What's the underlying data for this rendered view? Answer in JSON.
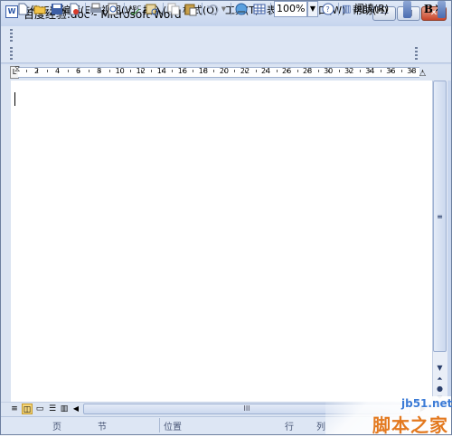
{
  "window": {
    "title": "百度经验.doc - Microsoft Word",
    "app_icon_label": "W",
    "min_glyph": "—",
    "max_glyph": "▢",
    "close_glyph": "✕"
  },
  "menu": {
    "items": [
      "文件(F)",
      "编辑(E)",
      "视图(V)",
      "插入(I)",
      "格式(O)",
      "工具(T)",
      "表格(A)",
      "窗口(W)",
      "帮助(H)"
    ],
    "close_doc_glyph": "×"
  },
  "toolbar": {
    "zoom": "100%",
    "read_button": "阅读(R)",
    "bold_label": "B",
    "icons": [
      "new-icon",
      "open-icon",
      "save-icon",
      "permission-icon",
      "print-icon",
      "print-preview-icon",
      "spelling-icon",
      "research-icon",
      "copy-icon",
      "paste-icon",
      "undo-icon",
      "undo-dropdown-icon",
      "hyperlink-icon",
      "table-icon",
      "help-icon"
    ]
  },
  "ruler": {
    "numbers": [
      "2",
      "4",
      "6",
      "8",
      "10",
      "12",
      "14",
      "16",
      "18",
      "20",
      "22",
      "24",
      "26",
      "28",
      "30",
      "32",
      "34",
      "36",
      "38"
    ]
  },
  "scroll": {
    "hthumb_glyph": "III"
  },
  "status": {
    "page_label": "页",
    "section_label": "节",
    "position_label": "位置",
    "line_label": "行",
    "column_label": "列"
  },
  "watermark": {
    "url": "jb51.net",
    "site_name": "脚本之家"
  },
  "colors": {
    "title_bar": "#c6d5ee",
    "toolbar_bg": "#dde6f4",
    "close_button": "#c9452a",
    "watermark_orange": "#e3791f",
    "watermark_blue": "#3b7bd6"
  }
}
